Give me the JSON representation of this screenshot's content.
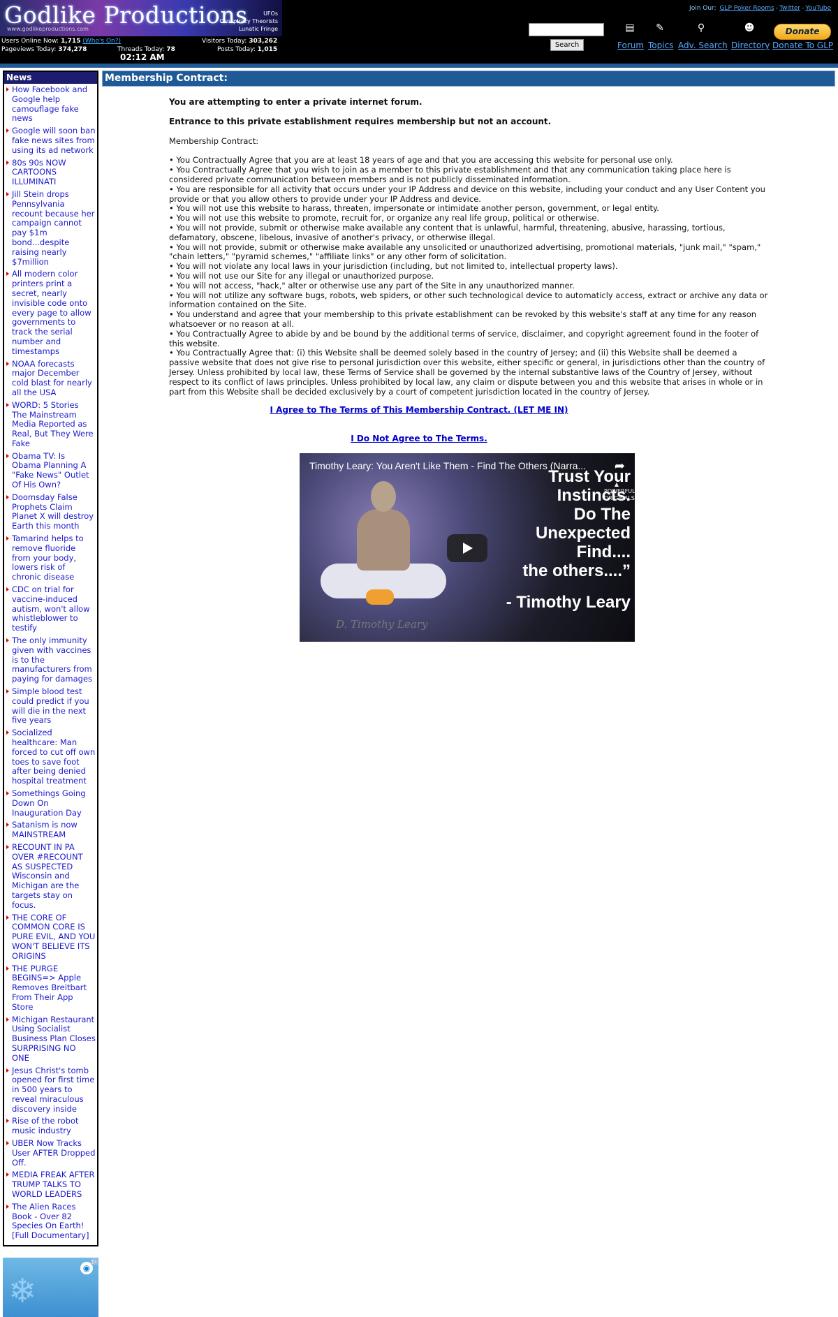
{
  "header": {
    "logo_title": "Godlike Productions",
    "logo_url": "www.godlikeproductions.com",
    "logo_tags": [
      "UFOs",
      "Conspiracy Theorists",
      "Lunatic Fringe"
    ],
    "stats": {
      "users_online_label": "Users Online Now:",
      "users_online_value": "1,715",
      "whos_on_label": "(Who's On?)",
      "visitors_today_label": "Visitors Today:",
      "visitors_today_value": "303,262",
      "pageviews_today_label": "Pageviews Today:",
      "pageviews_today_value": "374,278",
      "threads_today_label": "Threads Today:",
      "threads_today_value": "78",
      "posts_today_label": "Posts Today:",
      "posts_today_value": "1,015",
      "time": "02:12 AM"
    },
    "search_button": "Search",
    "join_our_label": "Join Our:",
    "join_links": [
      "GLP Poker Rooms",
      "Twitter",
      "YouTube"
    ],
    "nav": [
      {
        "label": "Forum",
        "icon": "forum-icon"
      },
      {
        "label": "Topics",
        "icon": "topics-icon"
      },
      {
        "label": "Adv. Search",
        "icon": "magnifier-icon"
      },
      {
        "label": "Directory",
        "icon": "directory-icon"
      },
      {
        "label": "Donate To GLP",
        "icon": "donate-icon"
      }
    ],
    "donate_button": "Donate",
    "colors": {
      "header_bg": "#000000",
      "stripe": "#1f5a96",
      "link": "#55aaff"
    }
  },
  "sidebar": {
    "title": "News",
    "items": [
      "How Facebook and Google help camouflage fake news",
      "Google will soon ban fake news sites from using its ad network",
      "80s 90s NOW CARTOONS ILLUMINATI",
      "Jill Stein drops Pennsylvania recount because her campaign cannot pay $1m bond...despite raising nearly $7million",
      "All modern color printers print a secret, nearly invisible code onto every page to allow governments to track the serial number and timestamps",
      "NOAA forecasts major December cold blast for nearly all the USA",
      "WORD: 5 Stories The Mainstream Media Reported as Real, But They Were Fake",
      "Obama TV: Is Obama Planning A \"Fake News\" Outlet Of His Own?",
      "Doomsday False Prophets Claim Planet X will destroy Earth this month",
      "Tamarind helps to remove fluoride from your body, lowers risk of chronic disease",
      "CDC on trial for vaccine-induced autism, won't allow whistleblower to testify",
      "The only immunity given with vaccines is to the manufacturers from paying for damages",
      "Simple blood test could predict if you will die in the next five years",
      "Socialized healthcare: Man forced to cut off own toes to save foot after being denied hospital treatment",
      "Somethings Going Down On Inauguration Day",
      "Satanism is now MAINSTREAM",
      "RECOUNT IN PA OVER #RECOUNT AS SUSPECTED Wisconsin and Michigan are the targets stay on focus.",
      "THE CORE OF COMMON CORE IS PURE EVIL, AND YOU WON'T BELIEVE ITS ORIGINS",
      "THE PURGE BEGINS=> Apple Removes Breitbart From Their App Store",
      "Michigan Restaurant Using Socialist Business Plan Closes SURPRISING NO ONE",
      "Jesus Christ's tomb opened for first time in 500 years to reveal miraculous discovery inside",
      "Rise of the robot music industry",
      "UBER Now Tracks User AFTER Dropped Off.",
      "MEDIA FREAK AFTER TRUMP TALKS TO WORLD LEADERS",
      "The Alien Races Book - Over 82 Species On Earth! [Full Documentary]"
    ]
  },
  "main": {
    "title": "Membership Contract:",
    "warning_1": "You are attempting to enter a private internet forum.",
    "warning_2": "Entrance to this private establishment requires membership but not an account.",
    "contract_label": "Membership Contract:",
    "terms": [
      "• You Contractually Agree that you are at least 18 years of age and that you are accessing this website for personal use only.",
      "• You Contractually Agree that you wish to join as a member to this private establishment and that any communication taking place here is considered private communication between members and is not publicly disseminated information.",
      "• You are responsible for all activity that occurs under your IP Address and device on this website, including your conduct and any User Content you provide or that you allow others to provide under your IP Address and device.",
      "• You will not use this website to harass, threaten, impersonate or intimidate another person, government, or legal entity.",
      "• You will not use this website to promote, recruit for, or organize any real life group, political or otherwise.",
      "• You will not provide, submit or otherwise make available any content that is unlawful, harmful, threatening, abusive, harassing, tortious, defamatory, obscene, libelous, invasive of another's privacy, or otherwise illegal.",
      "• You will not provide, submit or otherwise make available any unsolicited or unauthorized advertising, promotional materials, \"junk mail,\" \"spam,\" \"chain letters,\" \"pyramid schemes,\" \"affiliate links\" or any other form of solicitation.",
      "• You will not violate any local laws in your jurisdiction (including, but not limited to, intellectual property laws).",
      "• You will not use our Site for any illegal or unauthorized purpose.",
      "• You will not access, \"hack,\" alter or otherwise use any part of the Site in any unauthorized manner.",
      "• You will not utilize any software bugs, robots, web spiders, or other such technological device to automaticly access, extract or archive any data or information contained on the Site.",
      "• You understand and agree that your membership to this private establishment can be revoked by this website's staff at any time for any reason whatsoever or no reason at all.",
      "• You Contractually Agree to abide by and be bound by the additional terms of service, disclaimer, and copyright agreement found in the footer of this website.",
      "• You Contractually Agree that: (i) this Website shall be deemed solely based in the country of Jersey; and (ii) this Website shall be deemed a passive website that does not give rise to personal jurisdiction over this website, either specific or general, in jurisdictions other than the country of Jersey. Unless prohibited by local law, these Terms of Service shall be governed by the internal substantive laws of the Country of Jersey, without respect to its conflict of laws principles. Unless prohibited by local law, any claim or dispute between you and this website that arises in whole or in part from this Website shall be decided exclusively by a court of competent jurisdiction located in the country of Jersey."
    ],
    "agree_link": "I Agree to The Terms of This Membership Contract. (LET ME IN)",
    "disagree_link": "I Do Not Agree to The Terms.",
    "video": {
      "title": "Timothy Leary: You Aren't Like Them - Find The Others (Narra...",
      "quote_lines": [
        "Trust Your",
        "Instincts.",
        "Do The",
        "Unexpected",
        "Find....",
        "the others....”"
      ],
      "attribution": "- Timothy Leary",
      "watermark": "D. Timothy Leary",
      "badge": "POWERFUL ORIGINALS"
    }
  }
}
